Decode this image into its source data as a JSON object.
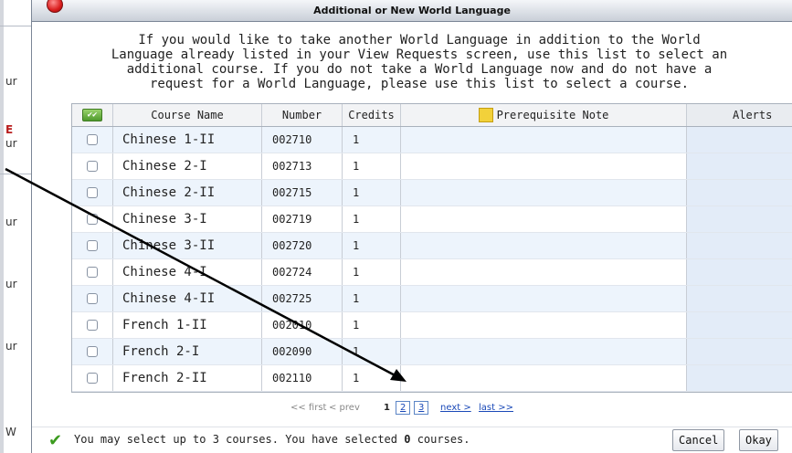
{
  "background": {
    "labels": [
      "ur",
      "E",
      "ur",
      "ur",
      "ur",
      "ur",
      "W"
    ]
  },
  "dialog": {
    "title": "Additional or New World Language",
    "intro_lines": [
      "If you would like to take another World Language in addition to the World",
      "Language already listed in your View Requests screen, use this list to select an",
      "additional course. If you do not take a World Language now and do not have a",
      "request for a World Language, please use this list to select a course."
    ],
    "columns": {
      "course_name": "Course Name",
      "number": "Number",
      "credits": "Credits",
      "prereq_note": "Prerequisite Note",
      "alerts": "Alerts",
      "sort_indicator": "▲"
    },
    "rows": [
      {
        "course": "Chinese 1-II",
        "number": "002710",
        "credits": "1"
      },
      {
        "course": "Chinese 2-I",
        "number": "002713",
        "credits": "1"
      },
      {
        "course": "Chinese 2-II",
        "number": "002715",
        "credits": "1"
      },
      {
        "course": "Chinese 3-I",
        "number": "002719",
        "credits": "1"
      },
      {
        "course": "Chinese 3-II",
        "number": "002720",
        "credits": "1"
      },
      {
        "course": "Chinese 4-I",
        "number": "002724",
        "credits": "1"
      },
      {
        "course": "Chinese 4-II",
        "number": "002725",
        "credits": "1"
      },
      {
        "course": "French 1-II",
        "number": "002010",
        "credits": "1"
      },
      {
        "course": "French 2-I",
        "number": "002090",
        "credits": "1"
      },
      {
        "course": "French 2-II",
        "number": "002110",
        "credits": "1"
      }
    ],
    "pager": {
      "first": "<< first",
      "prev": "< prev",
      "current": "1",
      "page2": "2",
      "page3": "3",
      "next": "next >",
      "last": "last >>"
    },
    "footer": {
      "status": "You may select up to 3 courses. You have selected ",
      "selected_count": "0",
      "status_suffix": " courses.",
      "cancel": "Cancel",
      "okay": "Okay"
    }
  },
  "colors": {
    "accent_blue": "#1a49b8",
    "row_alt": "#edf4fc",
    "check_green": "#3b9b1e",
    "close_red": "#d91d1d"
  }
}
